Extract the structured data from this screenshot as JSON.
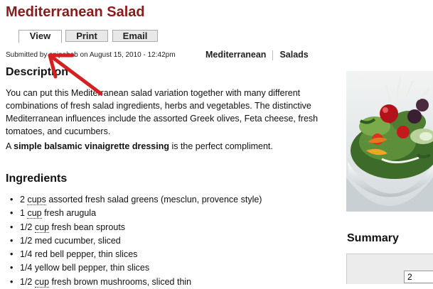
{
  "page": {
    "title": "Mediterranean Salad",
    "tabs": [
      {
        "label": "View",
        "active": true
      },
      {
        "label": "Print",
        "active": false
      },
      {
        "label": "Email",
        "active": false
      }
    ],
    "meta": {
      "submitted_prefix": "Submitted by",
      "author": "spipebob",
      "date": "on August 15, 2010 - 12:42pm"
    },
    "terms": [
      "Mediterranean",
      "Salads"
    ]
  },
  "description": {
    "heading": "Description",
    "paragraph": "You can put this Mediterranean salad variation together with many different combinations of fresh salad ingredients, herbs and vegetables. The distinctive Mediterranean influences include the assorted Greek olives, Feta cheese, fresh tomatoes, and cucumbers.",
    "second_prefix": "A ",
    "second_bold": "simple balsamic vinaigrette dressing",
    "second_suffix": " is the perfect compliment."
  },
  "ingredients": {
    "heading": "Ingredients",
    "items": [
      {
        "qty": "2",
        "unit": "cups",
        "text": "assorted fresh salad greens (mesclun, provence style)"
      },
      {
        "qty": "1",
        "unit": "cup",
        "text": "fresh arugula"
      },
      {
        "qty": "1/2",
        "unit": "cup",
        "text": "fresh bean sprouts"
      },
      {
        "qty": "1/2",
        "unit": "",
        "text": "med cucumber, sliced"
      },
      {
        "qty": "1/4",
        "unit": "",
        "text": "red bell pepper, thin slices"
      },
      {
        "qty": "1/4",
        "unit": "",
        "text": "yellow bell pepper, thin slices"
      },
      {
        "qty": "1/2",
        "unit": "cup",
        "text": "fresh brown mushrooms, sliced thin"
      }
    ]
  },
  "sidebar": {
    "summary_heading": "Summary",
    "servings_value": "2"
  },
  "colors": {
    "title": "#8b1a1a",
    "annotation_arrow": "#d42020"
  }
}
